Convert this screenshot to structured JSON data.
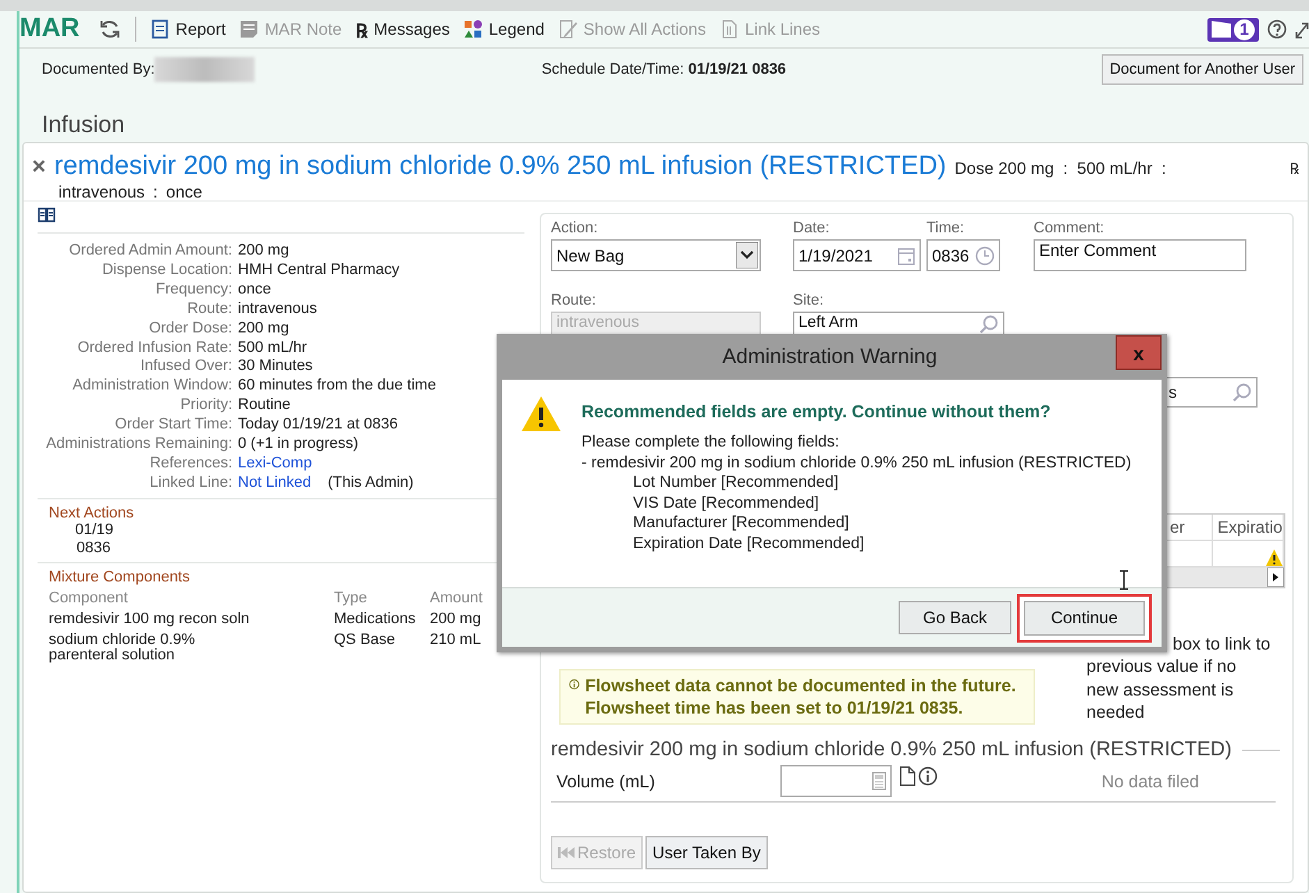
{
  "toolbar": {
    "title": "MAR",
    "items": [
      {
        "kind": "report",
        "label": "Report",
        "disabled": false
      },
      {
        "kind": "note",
        "label": "MAR Note",
        "disabled": true
      },
      {
        "kind": "rx",
        "icon": "℞",
        "label": "Messages",
        "disabled": false
      },
      {
        "kind": "legend",
        "label": "Legend",
        "disabled": false
      },
      {
        "kind": "actions",
        "label": "Show All Actions",
        "disabled": true
      },
      {
        "kind": "link",
        "label": "Link Lines",
        "disabled": true
      }
    ],
    "badge": "1"
  },
  "header": {
    "documented_by_label": "Documented By:",
    "schedule_label": "Schedule Date/Time:",
    "schedule_value": "01/19/21 0836",
    "button": "Document for Another User"
  },
  "section_title": "Infusion",
  "order": {
    "close": "×",
    "rx": "℞",
    "title": "remdesivir 200 mg in sodium chloride 0.9% 250 mL infusion (RESTRICTED)",
    "dose": "Dose 200 mg  :  500 mL/hr  :",
    "route": "intravenous",
    "separator": ":",
    "frequency": "once",
    "details": [
      {
        "label": "Ordered Admin Amount:",
        "value": "200 mg"
      },
      {
        "label": "Dispense Location:",
        "value": "HMH Central Pharmacy"
      },
      {
        "label": "Frequency:",
        "value": "once"
      },
      {
        "label": "Route:",
        "value": "intravenous"
      },
      {
        "label": "Order Dose:",
        "value": "200 mg"
      },
      {
        "label": "Ordered Infusion Rate:",
        "value": "500 mL/hr"
      },
      {
        "label": "Infused Over:",
        "value": "30 Minutes"
      },
      {
        "label": "Administration Window:",
        "value": "60 minutes from the due time"
      },
      {
        "label": "Priority:",
        "value": "Routine"
      },
      {
        "label": "Order Start Time:",
        "value": "Today 01/19/21 at 0836"
      },
      {
        "label": "Administrations Remaining:",
        "value": "0 (+1 in progress)"
      },
      {
        "label": "References:",
        "value": "Lexi-Comp",
        "kind": "link"
      },
      {
        "label": "Linked Line:",
        "value": "Not Linked",
        "kind": "link",
        "note": "(This Admin)"
      }
    ],
    "next_actions": {
      "title": "Next Actions",
      "date": "01/19",
      "time": "0836"
    },
    "mixture": {
      "title": "Mixture Components",
      "columns": [
        "Component",
        "Type",
        "Amount"
      ],
      "rows": [
        [
          "remdesivir 100 mg recon soln",
          "Medications",
          "200 mg"
        ],
        [
          "sodium chloride 0.9% parenteral solution",
          "QS Base",
          "210 mL"
        ]
      ]
    }
  },
  "form": {
    "fields": [
      {
        "kind": "select",
        "label": "Action:",
        "value": "New Bag",
        "disabled": false
      },
      {
        "kind": "date",
        "label": "Date:",
        "value": "1/19/2021",
        "disabled": false
      },
      {
        "kind": "time",
        "label": "Time:",
        "value": "0836",
        "disabled": false
      },
      {
        "kind": "text",
        "label": "Comment:",
        "placeholder": "Enter Comment",
        "disabled": false
      },
      {
        "kind": "text",
        "label": "Route:",
        "value": "intravenous",
        "disabled": true
      },
      {
        "kind": "search",
        "label": "Site:",
        "value": "Left Arm",
        "disabled": false
      }
    ],
    "partial_field": {
      "value": "s"
    },
    "table": {
      "columns": [
        "er",
        "Expiratio"
      ]
    },
    "hint_fragment": "box to link to",
    "hint": "previous value if no new assessment is needed",
    "banner": "Flowsheet data cannot be documented in the future. Flowsheet time has been set to 01/19/21 0835.",
    "group_title": "remdesivir 200 mg in sodium chloride 0.9% 250 mL infusion (RESTRICTED)",
    "volume_label": "Volume (mL)",
    "volume_status": "No data filed",
    "buttons": [
      {
        "label": "Restore",
        "disabled": true
      },
      {
        "label": "User Taken By",
        "disabled": false
      }
    ]
  },
  "dialog": {
    "title": "Administration Warning",
    "close": "x",
    "heading": "Recommended fields are empty. Continue without them?",
    "intro": "Please complete the following fields:",
    "item": "- remdesivir 200 mg in sodium chloride 0.9% 250 mL infusion (RESTRICTED)",
    "fields": [
      "Lot Number [Recommended]",
      "VIS Date [Recommended]",
      "Manufacturer [Recommended]",
      "Expiration Date [Recommended]"
    ],
    "buttons": [
      {
        "label": "Go Back",
        "highlighted": false
      },
      {
        "label": "Continue",
        "highlighted": true
      }
    ]
  }
}
